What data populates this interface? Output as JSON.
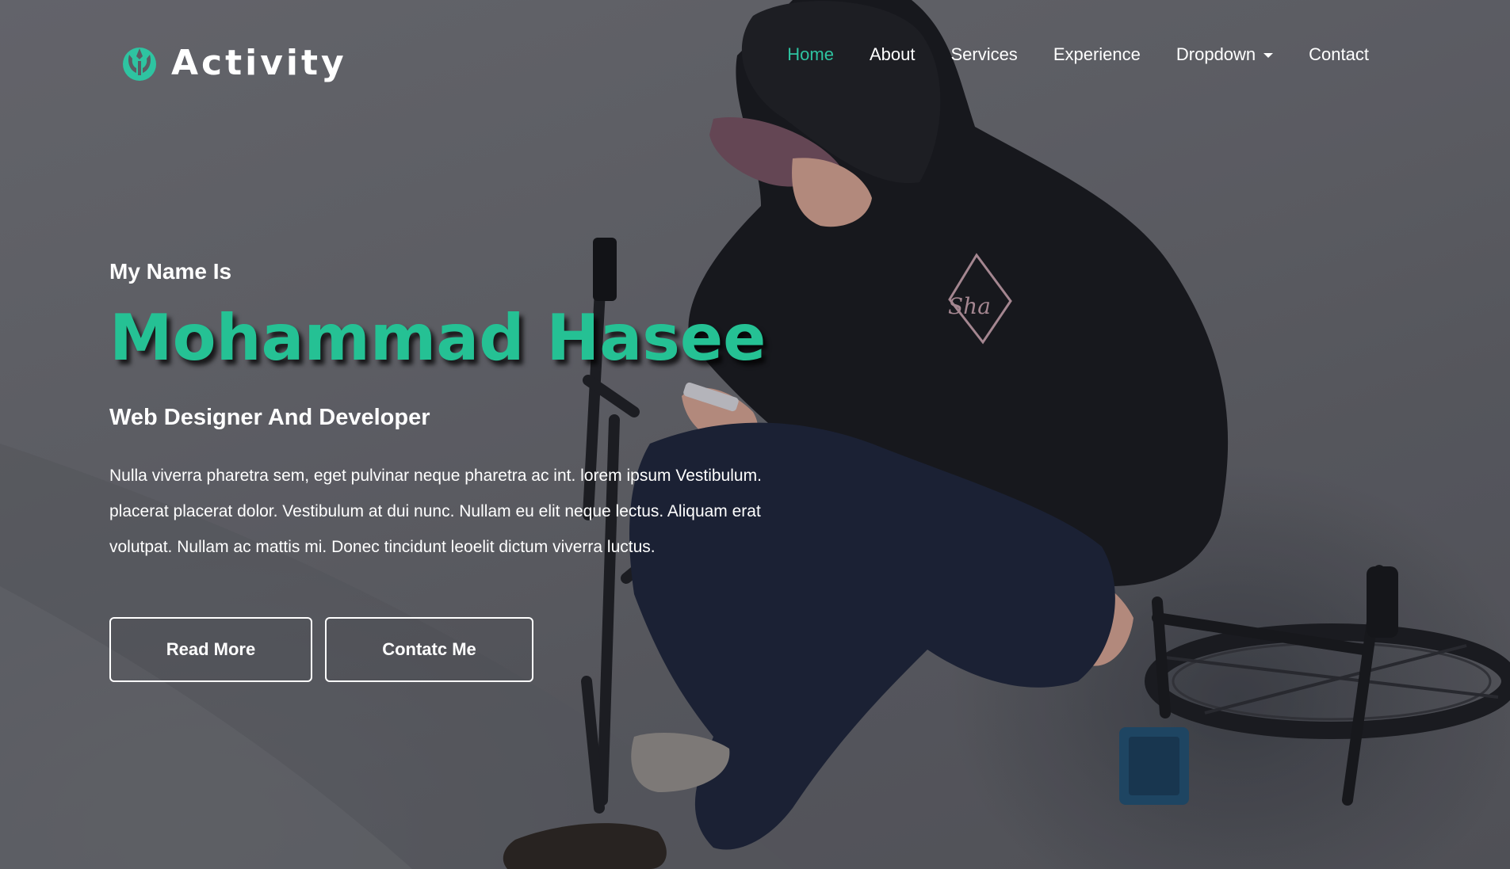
{
  "brand": {
    "name": "Activity",
    "icon": "rebel-alliance-icon",
    "accent_color": "#25c194"
  },
  "nav": {
    "items": [
      {
        "label": "Home",
        "active": true
      },
      {
        "label": "About",
        "active": false
      },
      {
        "label": "Services",
        "active": false
      },
      {
        "label": "Experience",
        "active": false
      },
      {
        "label": "Dropdown",
        "active": false,
        "has_caret": true
      },
      {
        "label": "Contact",
        "active": false
      }
    ],
    "active_color": "#2ec4a1"
  },
  "hero": {
    "intro": "My Name Is",
    "name": "Mohammad Hasee",
    "role": "Web Designer And Developer",
    "description": "Nulla viverra pharetra sem, eget pulvinar neque pharetra ac int. lorem ipsum Vestibulum. placerat placerat dolor. Vestibulum at dui nunc. Nullam eu elit neque lectus. Aliquam erat volutpat. Nullam ac mattis mi. Donec tincidunt leoelit dictum viverra luctus.",
    "buttons": {
      "read_more": "Read More",
      "contact": "Contatc Me"
    },
    "background": "photo-man-hoodie-sitting-on-bmx-bike-looking-at-phone"
  }
}
